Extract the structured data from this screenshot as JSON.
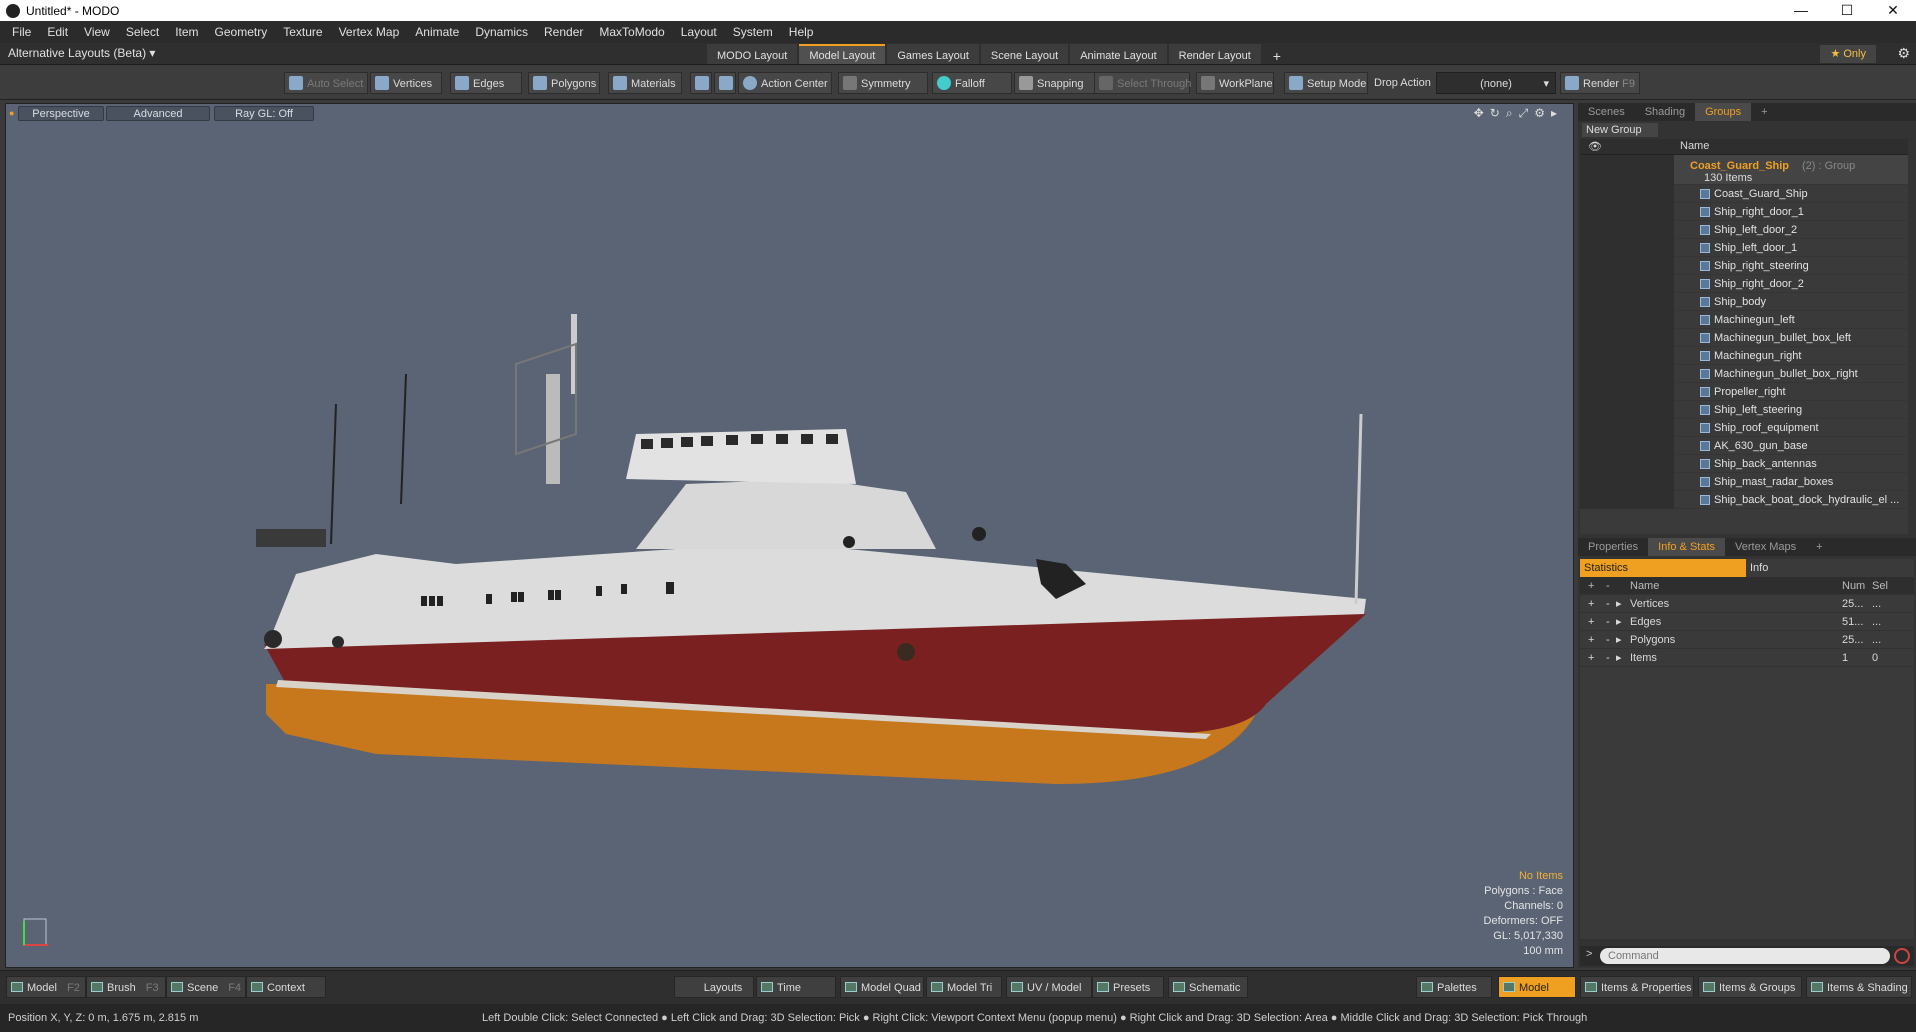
{
  "window": {
    "title": "Untitled* - MODO",
    "controls": [
      "—",
      "☐",
      "✕"
    ]
  },
  "menu": [
    "File",
    "Edit",
    "View",
    "Select",
    "Item",
    "Geometry",
    "Texture",
    "Vertex Map",
    "Animate",
    "Dynamics",
    "Render",
    "MaxToModo",
    "Layout",
    "System",
    "Help"
  ],
  "layoutbar": {
    "alt_layouts": "Alternative Layouts (Beta) ▾",
    "tabs": [
      "MODO Layout",
      "Model Layout",
      "Games Layout",
      "Scene Layout",
      "Animate Layout",
      "Render Layout"
    ],
    "active_tab": "Model Layout",
    "add": "+",
    "only": "★ Only"
  },
  "toolbar": {
    "auto_select": "Auto Select",
    "vertices": "Vertices",
    "edges": "Edges",
    "polygons": "Polygons",
    "materials": "Materials",
    "action_center": "Action Center",
    "symmetry": "Symmetry",
    "falloff": "Falloff",
    "snapping": "Snapping",
    "select_through": "Select Through",
    "workplane": "WorkPlane",
    "setup_mode": "Setup Mode",
    "drop_action_label": "Drop Action",
    "drop_action_value": "(none)",
    "render": "Render",
    "render_key": "F9"
  },
  "viewport": {
    "perspective": "Perspective",
    "advanced": "Advanced",
    "raygl": "Ray GL: Off",
    "stats": {
      "no_items": "No Items",
      "polygons": "Polygons : Face",
      "channels": "Channels: 0",
      "deformers": "Deformers: OFF",
      "gl": "GL: 5,017,330",
      "scale": "100 mm"
    }
  },
  "scene_panel": {
    "tabs": [
      "Scenes",
      "Shading",
      "Groups"
    ],
    "active_tab": "Groups",
    "new_group": "New Group",
    "col_name": "Name",
    "group_name": "Coast_Guard_Ship",
    "group_suffix": "(2) : Group",
    "group_count": "130 Items",
    "items": [
      "Coast_Guard_Ship",
      "Ship_right_door_1",
      "Ship_left_door_2",
      "Ship_left_door_1",
      "Ship_right_steering",
      "Ship_right_door_2",
      "Ship_body",
      "Machinegun_left",
      "Machinegun_bullet_box_left",
      "Machinegun_right",
      "Machinegun_bullet_box_right",
      "Propeller_right",
      "Ship_left_steering",
      "Ship_roof_equipment",
      "AK_630_gun_base",
      "Ship_back_antennas",
      "Ship_mast_radar_boxes",
      "Ship_back_boat_dock_hydraulic_el ..."
    ]
  },
  "props_panel": {
    "tabs": [
      "Properties",
      "Info & Stats",
      "Vertex Maps"
    ],
    "active_tab": "Info & Stats",
    "statistics": "Statistics",
    "info": "Info",
    "cols": {
      "name": "Name",
      "num": "Num",
      "sel": "Sel"
    },
    "rows": [
      {
        "name": "Vertices",
        "num": "25...",
        "sel": "..."
      },
      {
        "name": "Edges",
        "num": "51...",
        "sel": "..."
      },
      {
        "name": "Polygons",
        "num": "25...",
        "sel": "..."
      },
      {
        "name": "Items",
        "num": "1",
        "sel": "0"
      }
    ],
    "command_placeholder": "Command"
  },
  "bottombar": {
    "model": "Model",
    "model_key": "F2",
    "brush": "Brush",
    "brush_key": "F3",
    "scene": "Scene",
    "scene_key": "F4",
    "context": "Context",
    "layouts": "Layouts",
    "time": "Time",
    "model_quad": "Model Quad",
    "model_tri": "Model Tri",
    "uv_model": "UV / Model",
    "presets": "Presets",
    "schematic": "Schematic",
    "palettes": "Palettes",
    "model_active": "Model",
    "items_props": "Items & Properties",
    "items_groups": "Items & Groups",
    "items_shading": "Items & Shading"
  },
  "status": {
    "position": "Position X, Y, Z:   0 m, 1.675 m, 2.815 m",
    "hint": "Left Double Click: Select Connected ● Left Click and Drag: 3D Selection: Pick ● Right Click: Viewport Context Menu (popup menu) ● Right Click and Drag: 3D Selection: Area ● Middle Click and Drag: 3D Selection: Pick Through"
  }
}
